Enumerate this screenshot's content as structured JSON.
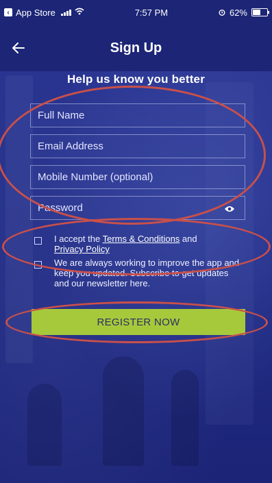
{
  "status_bar": {
    "back_app": "App Store",
    "time": "7:57 PM",
    "battery": "62%",
    "battery_level": 0.62
  },
  "header": {
    "back_icon": "arrow-left-icon",
    "title": "Sign Up"
  },
  "form": {
    "subtitle": "Help us know you better",
    "full_name_placeholder": "Full Name",
    "email_placeholder": "Email Address",
    "mobile_placeholder": "Mobile Number (optional)",
    "password_placeholder": "Password",
    "password_icon": "eye-icon",
    "terms_prefix": "I accept the ",
    "terms_link": "Terms & Conditions",
    "terms_and": " and",
    "privacy_link": "Privacy Policy",
    "newsletter_text": "We are always working to improve the app and keep you updated. Subscribe to get updates and our newsletter here.",
    "register_label": "REGISTER NOW"
  },
  "colors": {
    "header_bg": "#1c2576",
    "background": "#26318c",
    "register_button": "#a6c93c",
    "annotation_ellipse": "#c9504a"
  }
}
